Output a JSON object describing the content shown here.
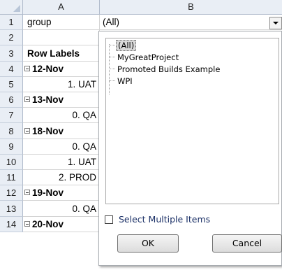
{
  "columns": [
    "A",
    "B"
  ],
  "rows": [
    {
      "num": "1",
      "a": "group",
      "a_style": "plain",
      "b": "(All)"
    },
    {
      "num": "2",
      "a": "",
      "a_style": "plain",
      "b": ""
    },
    {
      "num": "3",
      "a": "Row Labels",
      "a_style": "header",
      "b": ""
    },
    {
      "num": "4",
      "a": "12-Nov",
      "a_style": "group",
      "b": ""
    },
    {
      "num": "5",
      "a": "1. UAT",
      "a_style": "indent",
      "b": ""
    },
    {
      "num": "6",
      "a": "13-Nov",
      "a_style": "group",
      "b": ""
    },
    {
      "num": "7",
      "a": "0. QA",
      "a_style": "indent",
      "b": ""
    },
    {
      "num": "8",
      "a": "18-Nov",
      "a_style": "group",
      "b": ""
    },
    {
      "num": "9",
      "a": "0. QA",
      "a_style": "indent",
      "b": ""
    },
    {
      "num": "10",
      "a": "1. UAT",
      "a_style": "indent",
      "b": ""
    },
    {
      "num": "11",
      "a": "2. PROD",
      "a_style": "indent",
      "b": ""
    },
    {
      "num": "12",
      "a": "19-Nov",
      "a_style": "group",
      "b": ""
    },
    {
      "num": "13",
      "a": "0. QA",
      "a_style": "indent",
      "b": ""
    },
    {
      "num": "14",
      "a": "20-Nov",
      "a_style": "group",
      "b": ""
    }
  ],
  "filter_popup": {
    "items": [
      "(All)",
      "MyGreatProject",
      "Promoted Builds Example",
      "WPI"
    ],
    "selected_index": 0,
    "multi_label": "Select Multiple Items",
    "multi_checked": false,
    "ok_label": "OK",
    "cancel_label": "Cancel"
  },
  "colors": {
    "header_bg": "#e9eef5",
    "grid_line": "#d4d4d4",
    "link_text": "#1a2f66"
  }
}
